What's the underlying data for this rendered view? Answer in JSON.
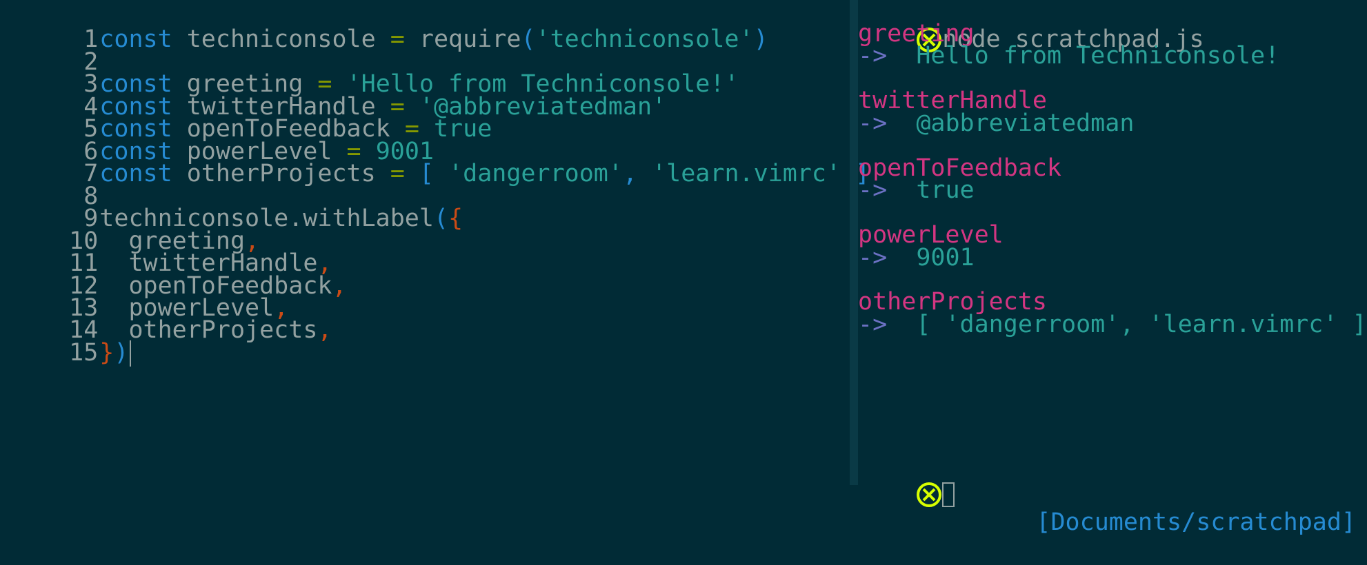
{
  "editor": {
    "lines": [
      {
        "num": "1",
        "kw": "const",
        "name": "techniconsole",
        "eq": "=",
        "fn": "require",
        "p1": "(",
        "str": "'techniconsole'",
        "p2": ")"
      },
      {
        "num": "2"
      },
      {
        "num": "3",
        "kw": "const",
        "name": "greeting",
        "eq": "=",
        "str": "'Hello from Techniconsole!'"
      },
      {
        "num": "4",
        "kw": "const",
        "name": "twitterHandle",
        "eq": "=",
        "str": "'@abbreviatedman'"
      },
      {
        "num": "5",
        "kw": "const",
        "name": "openToFeedback",
        "eq": "=",
        "lit": "true"
      },
      {
        "num": "6",
        "kw": "const",
        "name": "powerLevel",
        "eq": "=",
        "lit": "9001"
      },
      {
        "num": "7",
        "kw": "const",
        "name": "otherProjects",
        "eq": "=",
        "ob": "[",
        "s1": "'dangerroom'",
        "comma": ",",
        "s2": "'learn.vimrc'",
        "cb": "]"
      },
      {
        "num": "8"
      },
      {
        "num": "9",
        "call": "techniconsole.withLabel",
        "p1": "(",
        "brace": "{"
      },
      {
        "num": "10",
        "item": "greeting",
        "comma": ","
      },
      {
        "num": "11",
        "item": "twitterHandle",
        "comma": ","
      },
      {
        "num": "12",
        "item": "openToFeedback",
        "comma": ","
      },
      {
        "num": "13",
        "item": "powerLevel",
        "comma": ","
      },
      {
        "num": "14",
        "item": "otherProjects",
        "comma": ","
      },
      {
        "num": "15",
        "brace": "}",
        "p2": ")"
      }
    ]
  },
  "terminal": {
    "command": "node scratchpad.js",
    "arrow": "->",
    "outputs": [
      {
        "label": "greeting",
        "value": "Hello from Techniconsole!"
      },
      {
        "label": "twitterHandle",
        "value": "@abbreviatedman"
      },
      {
        "label": "openToFeedback",
        "value": "true"
      },
      {
        "label": "powerLevel",
        "value": "9001"
      },
      {
        "label": "otherProjects",
        "value": "[ 'dangerroom', 'learn.vimrc' ]"
      }
    ],
    "cwd": "[Documents/scratchpad]"
  },
  "colors": {
    "background": "#012b36",
    "keyword": "#268bd2",
    "string": "#2aa198",
    "operator": "#859900",
    "label": "#d33682",
    "prompt_icon": "#d7ff00"
  },
  "icons": {
    "prompt": "x-circle-icon"
  }
}
